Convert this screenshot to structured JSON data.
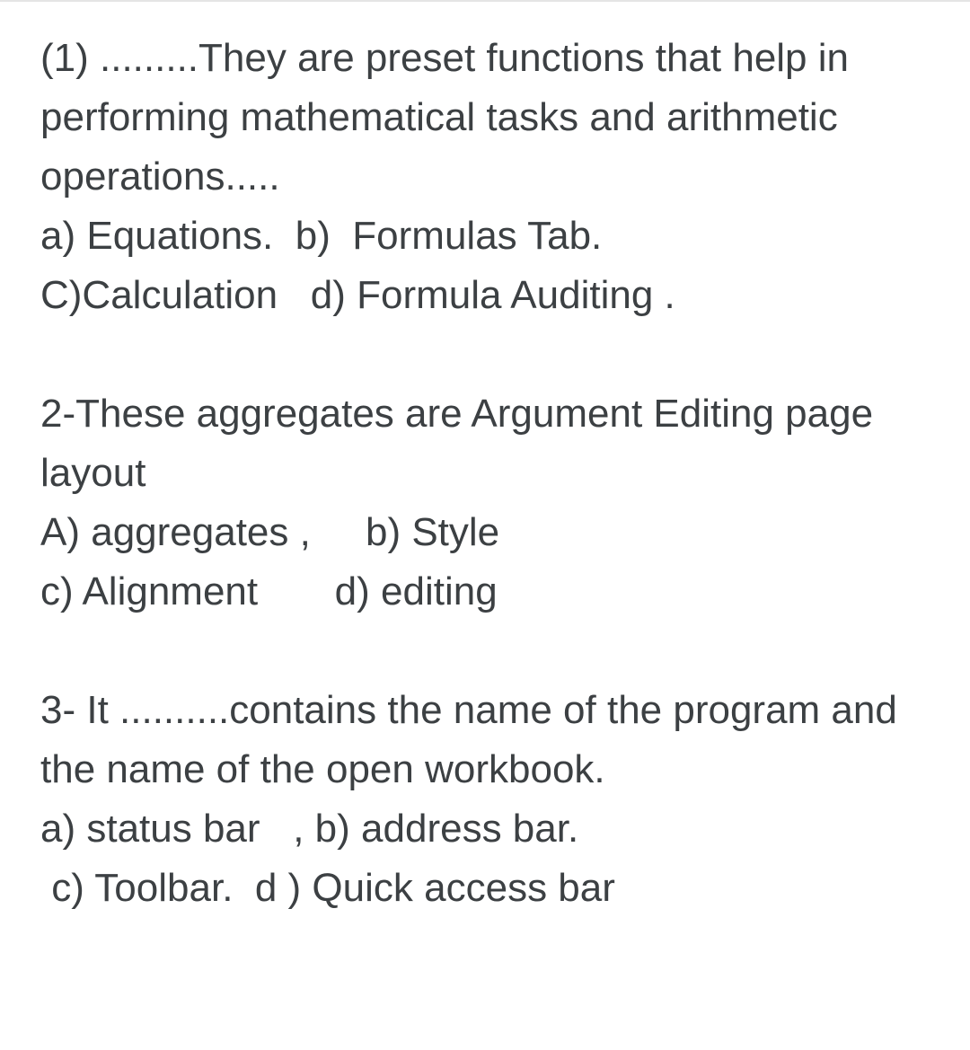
{
  "questions": [
    {
      "prompt": "(1) .........They are preset functions that help in performing mathematical tasks and arithmetic operations.....",
      "options_line1": "a) Equations.  b)  Formulas Tab.",
      "options_line2": "C)Calculation   d) Formula Auditing ."
    },
    {
      "prompt": "2-These aggregates are Argument Editing page layout",
      "options_line1": "A) aggregates ,     b) Style",
      "options_line2": "c) Alignment       d) editing"
    },
    {
      "prompt": "3- It ..........contains the name of the program and the name of the open workbook.",
      "options_line1": "a) status bar   , b) address bar.",
      "options_line2": " c) Toolbar.  d ) Quick access bar"
    }
  ]
}
